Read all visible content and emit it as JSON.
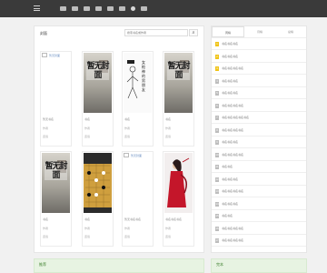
{
  "header": {
    "menu_icon": "hamburger-icon",
    "nav": [
      "首页",
      "玄幻",
      "仙侠",
      "都市",
      "历史",
      "网游",
      "科幻",
      "书库",
      "全本"
    ]
  },
  "main": {
    "title": "封面",
    "search_placeholder": "搜索书名或作者",
    "search_icon": "search-icon",
    "books": [
      {
        "title": "暂无书名",
        "author": "作者",
        "status": "连载",
        "cover": "broken",
        "cover_alt": "暂无封面"
      },
      {
        "title": "书名",
        "author": "作者",
        "status": "连载",
        "cover": "nocover",
        "cover_text": "暂无封面"
      },
      {
        "title": "书名",
        "author": "作者",
        "status": "连载",
        "cover": "sketch",
        "cover_text": "女枪神的男朋友"
      },
      {
        "title": "书名",
        "author": "作者",
        "status": "连载",
        "cover": "nocover",
        "cover_text": "暂无封面"
      },
      {
        "title": "书名",
        "author": "作者",
        "status": "连载",
        "cover": "nocover",
        "cover_text": "暂无封面"
      },
      {
        "title": "书名",
        "author": "作者",
        "status": "连载",
        "cover": "chess",
        "cover_text": ""
      },
      {
        "title": "暂无书名书名",
        "author": "作者",
        "status": "连载",
        "cover": "broken",
        "cover_alt": "暂无封面"
      },
      {
        "title": "书名书名书名",
        "author": "作者",
        "status": "连载",
        "cover": "red",
        "cover_text": ""
      }
    ]
  },
  "sidebar": {
    "tabs": [
      "周榜",
      "月榜",
      "总榜"
    ],
    "ranking": [
      {
        "num": "1",
        "name": "书名书名书名"
      },
      {
        "num": "2",
        "name": "书名书名书名"
      },
      {
        "num": "3",
        "name": "书名书名书名书名"
      },
      {
        "num": "4",
        "name": "书名书名书名"
      },
      {
        "num": "5",
        "name": "书名书名书名"
      },
      {
        "num": "6",
        "name": "书名书名书名书名"
      },
      {
        "num": "7",
        "name": "书名书名书名书名书名"
      },
      {
        "num": "8",
        "name": "书名书名书名书名"
      },
      {
        "num": "9",
        "name": "书名书名书名"
      },
      {
        "num": "10",
        "name": "书名书名书名书名"
      },
      {
        "num": "11",
        "name": "书名书名"
      },
      {
        "num": "12",
        "name": "书名书名书名"
      },
      {
        "num": "13",
        "name": "书名书名书名书名"
      },
      {
        "num": "14",
        "name": "书名书名书名"
      },
      {
        "num": "15",
        "name": "书名书名"
      },
      {
        "num": "16",
        "name": "书名书名书名书名"
      },
      {
        "num": "17",
        "name": "书名书名书名书名"
      }
    ]
  },
  "bottom": {
    "left_title": "推荐",
    "right_title": "完本"
  },
  "colors": {
    "topbar": "#3a3a3a",
    "accent_rank": "#f0c419",
    "green_bar": "#e7f3e2"
  }
}
